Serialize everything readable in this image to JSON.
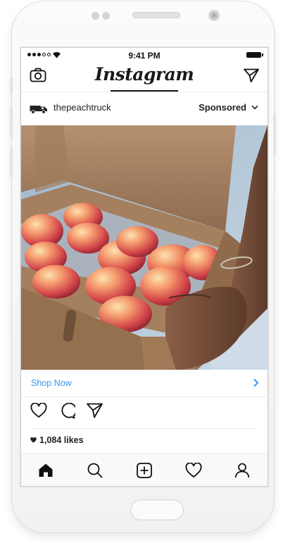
{
  "status_bar": {
    "time": "9:41 PM"
  },
  "header": {
    "logo_text": "Instagram"
  },
  "post": {
    "username": "thepeachtruck",
    "sponsored_label": "Sponsored",
    "image_alt": "Hands holding a cardboard box of fresh peaches"
  },
  "cta": {
    "label": "Shop Now"
  },
  "likes": {
    "text": "1,084 likes"
  },
  "icons": {
    "header": [
      "camera-icon",
      "direct-send-icon"
    ],
    "actions": [
      "heart-icon",
      "comment-icon",
      "share-icon"
    ],
    "tabs": [
      "home-icon",
      "search-icon",
      "add-post-icon",
      "activity-heart-icon",
      "profile-icon"
    ]
  },
  "colors": {
    "accent_link": "#3897f0",
    "text": "#1f1f1f",
    "tab_bar_bg": "#f9f9f9"
  }
}
